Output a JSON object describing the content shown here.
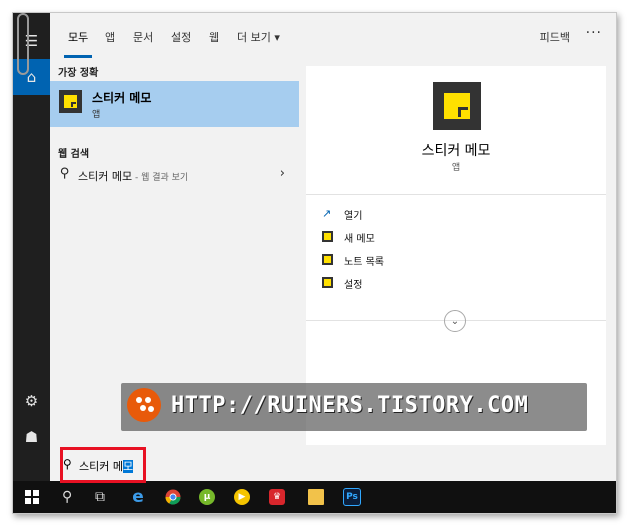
{
  "tabs": [
    {
      "label": "모두"
    },
    {
      "label": "앱"
    },
    {
      "label": "문서"
    },
    {
      "label": "설정"
    },
    {
      "label": "웹"
    },
    {
      "label": "더 보기 ▾"
    }
  ],
  "topbar": {
    "feedback": "피드백",
    "more": "···"
  },
  "results": {
    "best_match_title": "가장 정확",
    "best_match": {
      "name": "스티커 메모",
      "type": "앱"
    },
    "web_search_title": "웹 검색",
    "web_search": {
      "query": "스티커 메모",
      "hint": " - 웹 결과 보기"
    }
  },
  "detail": {
    "name": "스티커 메모",
    "type": "앱",
    "actions": [
      {
        "label": "열기"
      },
      {
        "label": "새 메모"
      },
      {
        "label": "노트 목록"
      },
      {
        "label": "설정"
      }
    ]
  },
  "search": {
    "query_prefix": "스티커 메",
    "query_selected": "모"
  },
  "watermark": {
    "text": "HTTP://RUINERS.TISTORY.COM"
  },
  "taskbar": {
    "photoshop_label": "Ps"
  },
  "colors": {
    "accent": "#0063b1",
    "selection": "#a6cdef",
    "highlight_box": "#e81123",
    "note_yellow": "#ffe000"
  }
}
